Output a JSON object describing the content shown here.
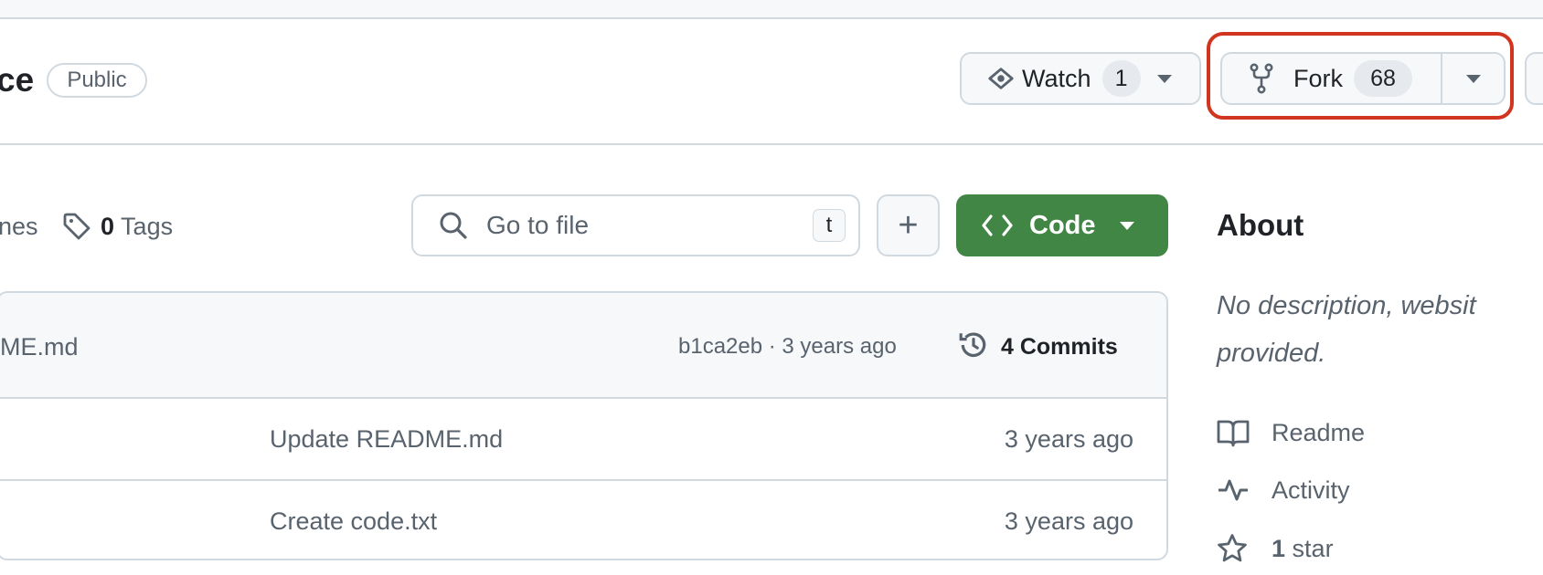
{
  "repo": {
    "title_fragment": "ce",
    "visibility": "Public"
  },
  "actions": {
    "watch": {
      "label": "Watch",
      "count": "1",
      "icon": "eye-icon"
    },
    "fork": {
      "label": "Fork",
      "count": "68",
      "icon": "repo-forked-icon"
    },
    "highlight_color": "#d1341f"
  },
  "toolbar": {
    "branches_fragment": "nes",
    "tags_count": "0",
    "tags_label": "Tags",
    "search_placeholder": "Go to file",
    "search_shortcut": "t",
    "add_label": "+",
    "code_label": "Code",
    "code_color": "#418644"
  },
  "latest_commit": {
    "message_fragment": "ME.md",
    "meta": "b1ca2eb · 3 years ago",
    "commits": "4 Commits"
  },
  "files": [
    {
      "message": "Update README.md",
      "time": "3 years ago"
    },
    {
      "message": "Create code.txt",
      "time": "3 years ago"
    }
  ],
  "about": {
    "heading": "About",
    "description_line1": "No description, websit",
    "description_line2": "provided.",
    "links": [
      {
        "label": "Readme",
        "icon": "book-icon"
      },
      {
        "label": "Activity",
        "icon": "pulse-icon"
      },
      {
        "count": "1",
        "label": "star",
        "icon": "star-icon"
      }
    ]
  }
}
